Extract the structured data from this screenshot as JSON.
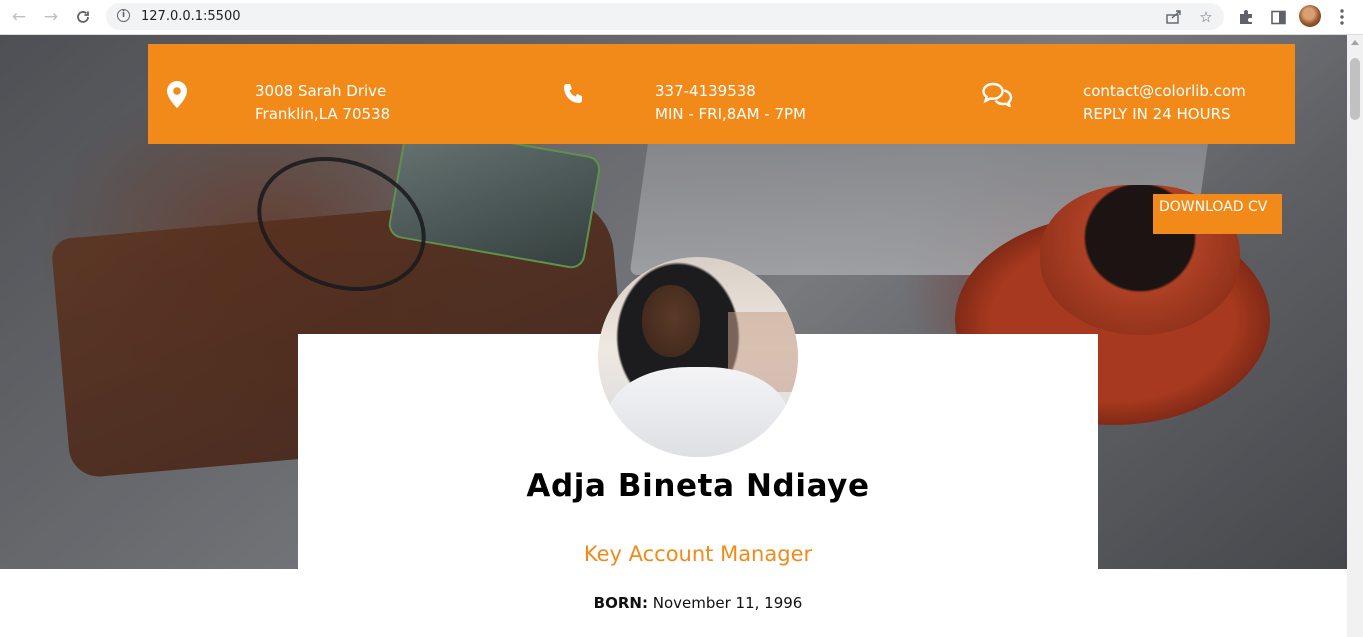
{
  "browser": {
    "url": "127.0.0.1:5500",
    "icons": {
      "back": "arrow-left-icon",
      "forward": "arrow-right-icon",
      "reload": "reload-icon",
      "info": "info-icon",
      "share": "share-icon",
      "bookmark": "star-icon",
      "extensions": "puzzle-icon",
      "side_panel": "side-panel-icon",
      "menu": "kebab-menu-icon"
    }
  },
  "contact": {
    "address": {
      "icon": "map-pin-icon",
      "line1": "3008 Sarah Drive",
      "line2": "Franklin,LA 70538"
    },
    "phone": {
      "icon": "phone-icon",
      "line1": "337-4139538",
      "line2": "MIN - FRI,8AM - 7PM"
    },
    "email": {
      "icon": "chat-bubbles-icon",
      "line1": "contact@colorlib.com",
      "line2": "REPLY IN 24 HOURS"
    }
  },
  "download_cv": "DOWNLOAD CV",
  "profile": {
    "name": "Adja Bineta Ndiaye",
    "role": "Key Account Manager",
    "born_label": "BORN:",
    "born_value": "November 11, 1996"
  },
  "colors": {
    "accent": "#f28a1a",
    "text": "#000000",
    "card": "#ffffff"
  }
}
